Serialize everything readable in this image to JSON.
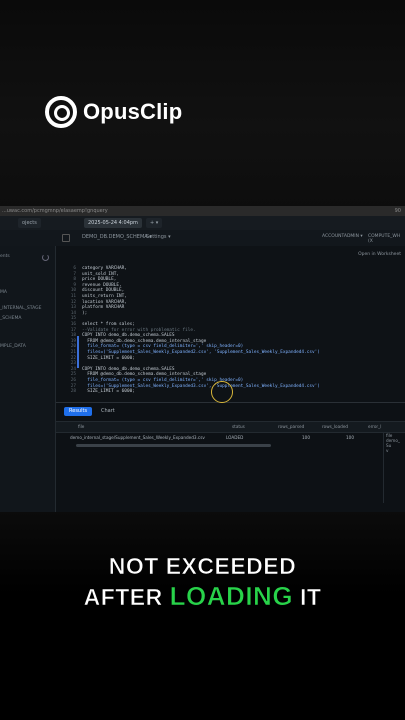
{
  "logo": {
    "text": "OpusClip"
  },
  "browser": {
    "url": "...uwac.com/pcmgmnp/elasaemp!gnquery",
    "right": "90"
  },
  "tabs": [
    {
      "label": "ojects"
    },
    {
      "label": "2025-05-24 4:04pm"
    },
    {
      "label": "+ ▾"
    }
  ],
  "header": {
    "breadcrumb": "DEMO_DB.DEMO_SCHEMA ▾",
    "settings": "Settings ▾",
    "account": "ACCOUNTADMIN ▾",
    "warehouse": "COMPUTE_WH (X",
    "open_ws": "Open in Worksheet"
  },
  "sidebar": {
    "items": [
      "ents",
      "MA",
      "_INTERNAL_STAGE",
      "_SCHEMA",
      "MPLE_DATA"
    ]
  },
  "editor": {
    "line_numbers": [
      "6",
      "7",
      "8",
      "9",
      "10",
      "11",
      "12",
      "13",
      "14",
      "15",
      "16",
      "17",
      "18",
      "19",
      "20",
      "21",
      "22",
      "23",
      "24",
      "25",
      "26",
      "27",
      "28"
    ],
    "lines": [
      "category VARCHAR,",
      "unit_sold INT,",
      "price DOUBLE,",
      "revenue DOUBLE,",
      "discount DOUBLE,",
      "units_return INT,",
      "location VARCHAR,",
      "platform VARCHAR",
      ");",
      "",
      "select * from sales;",
      "--Validate for error with problematic file.",
      "COPY INTO demo_db.demo_schema.SALES",
      "  FROM @demo_db.demo_schema.demo_internal_stage",
      "  file_format= (type = csv field_delimiter=',' skip_header=0)",
      "  files=('Supplement_Sales_Weekly_Expanded2.csv', 'Supplement_Sales_Weekly_Expanded4.csv')",
      "  SIZE_LIMIT = 6000;",
      "",
      "COPY INTO demo_db.demo_schema.SALES",
      "  FROM @demo_db.demo_schema.demo_internal_stage",
      "  file_format= (type = csv field_delimiter=',' skip_header=0)",
      "  files=('Supplement_Sales_Weekly_Expanded3.csv', 'Supplement_Sales_Weekly_Expanded4.csv')",
      "  SIZE_LIMIT = 6000;"
    ]
  },
  "results": {
    "tab_results": "Results",
    "tab_chart": "Chart",
    "columns": [
      "file",
      "status",
      "rows_parsed",
      "rows_loaded",
      "error_l"
    ],
    "row": {
      "file": "demo_internal_stage/Supplement_Sales_Weekly_Expanded3.csv",
      "status": "LOADED",
      "rows_parsed": "100",
      "rows_loaded": "100",
      "error": "0"
    },
    "side_detail": "file\ndemo_\nSu\nv"
  },
  "caption": {
    "line1": "NOT EXCEEDED",
    "line2_white_before": "AFTER",
    "line2_green": "LOADING",
    "line2_white_after": "IT"
  }
}
